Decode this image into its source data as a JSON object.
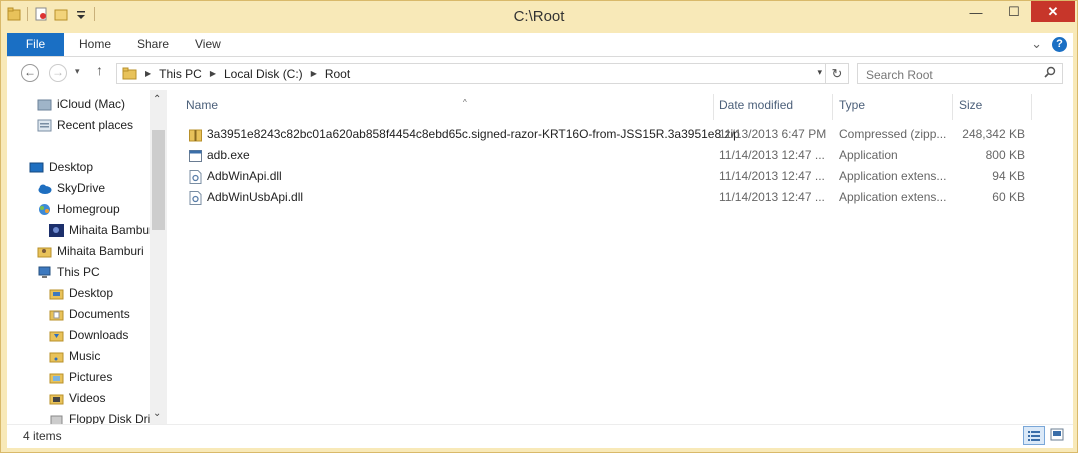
{
  "window": {
    "title": "C:\\Root",
    "min_label": "—",
    "max_label": "☐",
    "close_label": "✕"
  },
  "ribbon": {
    "tabs": [
      "File",
      "Home",
      "Share",
      "View"
    ],
    "help_label": "?",
    "expand_label": "⌄"
  },
  "address": {
    "back_label": "←",
    "forward_label": "→",
    "recent_label": "▾",
    "up_label": "↑",
    "segments": [
      "This PC",
      "Local Disk (C:)",
      "Root"
    ],
    "separator": "▶",
    "dropdown_label": "▾",
    "refresh_label": "↻"
  },
  "search": {
    "placeholder": "Search Root",
    "icon_label": "🔍"
  },
  "nav": {
    "items": [
      {
        "label": "iCloud (Mac)",
        "icon": "icloud-icon"
      },
      {
        "label": "Recent places",
        "icon": "recent-places-icon"
      },
      {
        "label": "Desktop",
        "icon": "desktop-icon"
      },
      {
        "label": "SkyDrive",
        "icon": "skydrive-icon"
      },
      {
        "label": "Homegroup",
        "icon": "homegroup-icon"
      },
      {
        "label": "Mihaita Bamburi",
        "icon": "user-avatar-icon"
      },
      {
        "label": "Mihaita Bamburi",
        "icon": "user-folder-icon"
      },
      {
        "label": "This PC",
        "icon": "computer-icon"
      },
      {
        "label": "Desktop",
        "icon": "folder-icon"
      },
      {
        "label": "Documents",
        "icon": "folder-icon"
      },
      {
        "label": "Downloads",
        "icon": "folder-icon"
      },
      {
        "label": "Music",
        "icon": "folder-icon"
      },
      {
        "label": "Pictures",
        "icon": "folder-icon"
      },
      {
        "label": "Videos",
        "icon": "folder-icon"
      },
      {
        "label": "Floppy Disk Dri",
        "icon": "floppy-icon"
      }
    ],
    "scroll_up": "⌃",
    "scroll_down": "⌄"
  },
  "list": {
    "columns": [
      "Name",
      "Date modified",
      "Type",
      "Size"
    ],
    "sort_indicator": "^",
    "rows": [
      {
        "name": "3a3951e8243c82bc01a620ab858f4454c8ebd65c.signed-razor-KRT16O-from-JSS15R.3a3951e8.zip",
        "date": "11/13/2013 6:47 PM",
        "type": "Compressed (zipp...",
        "size": "248,342 KB",
        "icon": "zip-folder-icon"
      },
      {
        "name": "adb.exe",
        "date": "11/14/2013 12:47 ...",
        "type": "Application",
        "size": "800 KB",
        "icon": "exe-icon"
      },
      {
        "name": "AdbWinApi.dll",
        "date": "11/14/2013 12:47 ...",
        "type": "Application extens...",
        "size": "94 KB",
        "icon": "dll-icon"
      },
      {
        "name": "AdbWinUsbApi.dll",
        "date": "11/14/2013 12:47 ...",
        "type": "Application extens...",
        "size": "60 KB",
        "icon": "dll-icon"
      }
    ]
  },
  "status": {
    "item_count": "4 items"
  },
  "colors": {
    "accent": "#1a6fc4",
    "frame": "#f8e9b8",
    "close": "#c7362a",
    "folder": "#e8c25a"
  }
}
